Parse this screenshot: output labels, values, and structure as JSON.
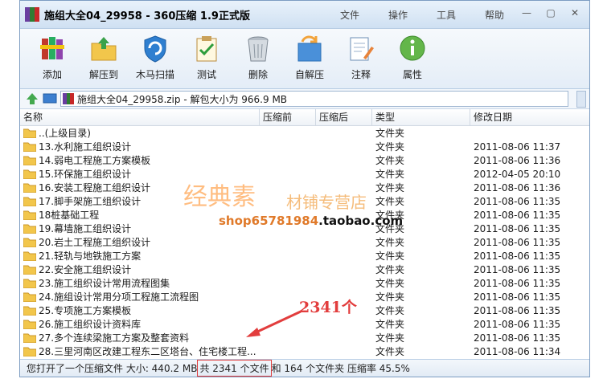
{
  "window": {
    "title": "施组大全04_29958 - 360压缩 1.9正式版",
    "menu": [
      "文件",
      "操作",
      "工具",
      "帮助"
    ]
  },
  "toolbar": [
    {
      "label": "添加",
      "icon": "add-books-icon"
    },
    {
      "label": "解压到",
      "icon": "extract-folder-icon"
    },
    {
      "label": "木马扫描",
      "icon": "shield-scan-icon"
    },
    {
      "label": "测试",
      "icon": "test-clipboard-icon"
    },
    {
      "label": "删除",
      "icon": "trash-icon"
    },
    {
      "label": "自解压",
      "icon": "self-extract-icon"
    },
    {
      "label": "注释",
      "icon": "comment-pen-icon"
    },
    {
      "label": "属性",
      "icon": "info-icon"
    }
  ],
  "address": {
    "path": "施组大全04_29958.zip - 解包大小为 966.9 MB"
  },
  "columns": [
    "名称",
    "压缩前",
    "压缩后",
    "类型",
    "修改日期"
  ],
  "files": [
    {
      "name": "..(上级目录)",
      "type": "文件夹",
      "date": ""
    },
    {
      "name": "13.水利施工组织设计",
      "type": "文件夹",
      "date": "2011-08-06 11:37"
    },
    {
      "name": "14.弱电工程施工方案模板",
      "type": "文件夹",
      "date": "2011-08-06 11:36"
    },
    {
      "name": "15.环保施工组织设计",
      "type": "文件夹",
      "date": "2012-04-05 20:10"
    },
    {
      "name": "16.安装工程施工组织设计",
      "type": "文件夹",
      "date": "2011-08-06 11:36"
    },
    {
      "name": "17.脚手架施工组织设计",
      "type": "文件夹",
      "date": "2011-08-06 11:35"
    },
    {
      "name": "18桩基础工程",
      "type": "文件夹",
      "date": "2011-08-06 11:35"
    },
    {
      "name": "19.幕墙施工组织设计",
      "type": "文件夹",
      "date": "2011-08-06 11:35"
    },
    {
      "name": "20.岩土工程施工组织设计",
      "type": "文件夹",
      "date": "2011-08-06 11:35"
    },
    {
      "name": "21.轻轨与地铁施工方案",
      "type": "文件夹",
      "date": "2011-08-06 11:35"
    },
    {
      "name": "22.安全施工组织设计",
      "type": "文件夹",
      "date": "2011-08-06 11:35"
    },
    {
      "name": "23.施工组织设计常用流程图集",
      "type": "文件夹",
      "date": "2011-08-06 11:35"
    },
    {
      "name": "24.施组设计常用分项工程施工流程图",
      "type": "文件夹",
      "date": "2011-08-06 11:35"
    },
    {
      "name": "25.专项施工方案模板",
      "type": "文件夹",
      "date": "2011-08-06 11:35"
    },
    {
      "name": "26.施工组织设计资料库",
      "type": "文件夹",
      "date": "2011-08-06 11:35"
    },
    {
      "name": "27.多个连续梁施工方案及整套资料",
      "type": "文件夹",
      "date": "2011-08-06 11:35"
    },
    {
      "name": "28.三里河南区改建工程东二区塔台、住宅楼工程...",
      "type": "文件夹",
      "date": "2011-08-06 11:34"
    }
  ],
  "status": {
    "prefix": "您打开了一个压缩文件 大小: 440.2 MB",
    "highlight": "共 2341 个文件",
    "suffix": "和 164 个文件夹 压缩率 45.5%"
  },
  "watermark": {
    "line1": "经典素",
    "line2": "材铺专营店",
    "line3a": "shop65781984",
    "line3b": ".taobao.com"
  },
  "annotation": "2341个",
  "colors": {
    "annotation": "#e23d3d",
    "folder": "#f2c64b",
    "titlebar": "#cfe0f2"
  }
}
